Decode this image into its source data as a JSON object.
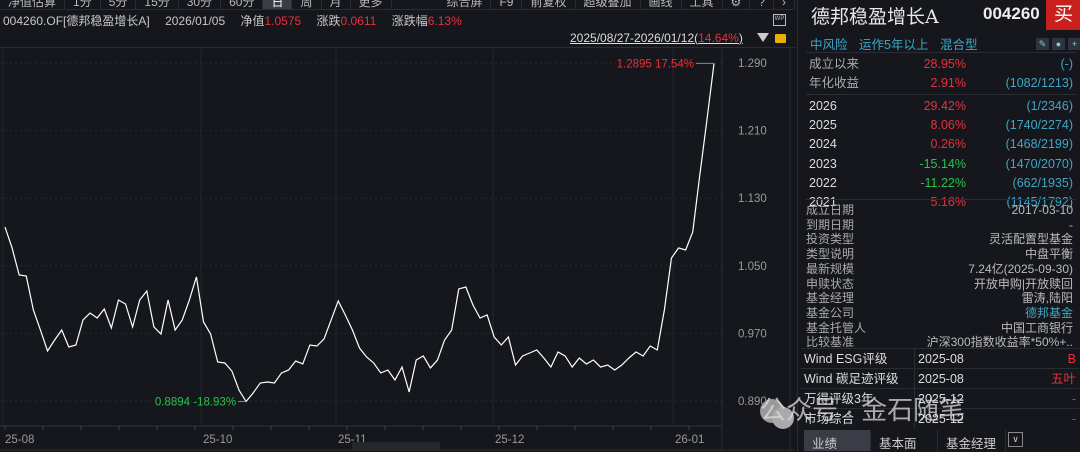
{
  "toolbar": {
    "items": [
      "净值估算",
      "1分",
      "5分",
      "15分",
      "30分",
      "60分",
      "日",
      "周",
      "月",
      "更多"
    ],
    "active": "日",
    "right_items": [
      "综合屏",
      "F9",
      "前复权",
      "超级叠加",
      "画线",
      "工具"
    ],
    "icons": [
      "gear-icon",
      "help-icon",
      "chevron-right-icon"
    ]
  },
  "info": {
    "code_name": "004260.OF[德邦稳盈增长A]",
    "date": "2026/01/05",
    "nav_label": "净值",
    "nav": "1.0575",
    "chg_label": "涨跌",
    "chg": "0.0611",
    "pct_label": "涨跌幅",
    "pct": "6.13%"
  },
  "range": {
    "text": "2025/08/27-2026/01/12(",
    "pct": "14.64%",
    "close": ")"
  },
  "wp_label": "WP",
  "chart_data": {
    "type": "line",
    "start_date": "2025/08/27",
    "end_date": "2026/01/12",
    "ylim": [
      0.86,
      1.31
    ],
    "yticks": [
      "1.290",
      "1.210",
      "1.130",
      "1.050",
      "0.970",
      "0.890"
    ],
    "xticks": [
      "25-08",
      "25-10",
      "25-11",
      "25-12",
      "26-01"
    ],
    "grid": true,
    "color": "#ffffff",
    "max_label": "1.2895 17.54%",
    "min_label": "0.8894 -18.93%",
    "values": [
      1.0959,
      1.0711,
      1.0391,
      1.0379,
      0.9977,
      0.974,
      0.9492,
      0.9622,
      0.974,
      0.9539,
      0.9563,
      0.9859,
      0.9941,
      0.9882,
      0.9989,
      0.9764,
      1.0095,
      1.0048,
      0.9776,
      1.0095,
      1.0202,
      0.9776,
      0.9693,
      1.0095,
      0.974,
      0.9859,
      1.0095,
      1.0368,
      0.9835,
      0.9693,
      0.9362,
      0.935,
      0.9255,
      0.903,
      0.8894,
      0.8995,
      0.9113,
      0.9125,
      0.9113,
      0.9232,
      0.9267,
      0.9373,
      0.9338,
      0.9563,
      0.9551,
      0.9634,
      0.9859,
      1.0084,
      0.9918,
      0.974,
      0.9527,
      0.9421,
      0.935,
      0.9232,
      0.9267,
      0.9149,
      0.9302,
      0.9007,
      0.9385,
      0.9433,
      0.9291,
      0.9385,
      0.9622,
      0.974,
      1.0226,
      1.0249,
      1.0036,
      0.9882,
      0.9918,
      0.9657,
      0.9563,
      0.9657,
      0.9326,
      0.9433,
      0.9468,
      0.9504,
      0.9409,
      0.9302,
      0.948,
      0.9433,
      0.9302,
      0.9409,
      0.9338,
      0.9385,
      0.9302,
      0.9326,
      0.9267,
      0.9326,
      0.9409,
      0.948,
      0.9433,
      0.9551,
      0.9504,
      0.9977,
      1.0592,
      1.0711,
      1.0687,
      1.09,
      1.1575,
      1.2225,
      1.2895
    ]
  },
  "panel": {
    "title": "德邦稳盈增长A",
    "code": "004260",
    "buy": "买",
    "tags": [
      "中风险",
      "运作5年以上",
      "混合型"
    ],
    "perf": [
      {
        "k": "成立以来",
        "v": "28.95%",
        "rank": "(-)",
        "c": "red"
      },
      {
        "k": "年化收益",
        "v": "2.91%",
        "rank": "(1082/1213)",
        "c": "red"
      },
      {
        "k": "2026",
        "v": "29.42%",
        "rank": "(1/2346)",
        "c": "red"
      },
      {
        "k": "2025",
        "v": "8.06%",
        "rank": "(1740/2274)",
        "c": "red"
      },
      {
        "k": "2024",
        "v": "0.26%",
        "rank": "(1468/2199)",
        "c": "red"
      },
      {
        "k": "2023",
        "v": "-15.14%",
        "rank": "(1470/2070)",
        "c": "grn"
      },
      {
        "k": "2022",
        "v": "-11.22%",
        "rank": "(662/1935)",
        "c": "grn"
      },
      {
        "k": "2021",
        "v": "5.16%",
        "rank": "(1145/1792)",
        "c": "red"
      }
    ],
    "details": [
      {
        "k": "成立日期",
        "v": "2017-03-10"
      },
      {
        "k": "到期日期",
        "v": "-"
      },
      {
        "k": "投资类型",
        "v": "灵活配置型基金"
      },
      {
        "k": "类型说明",
        "v": "中盘平衡"
      },
      {
        "k": "最新规模",
        "v": "7.24亿(2025-09-30)"
      },
      {
        "k": "申赎状态",
        "v": "开放申购|开放赎回"
      },
      {
        "k": "基金经理",
        "v": "雷涛,陆阳"
      },
      {
        "k": "基金公司",
        "v": "德邦基金"
      },
      {
        "k": "基金托管人",
        "v": "中国工商银行"
      },
      {
        "k": "比较基准",
        "v": "沪深300指数收益率*50%+.."
      }
    ],
    "ratings": [
      {
        "k": "Wind ESG评级",
        "d": "2025-08",
        "v": "B"
      },
      {
        "k": "Wind 碳足迹评级",
        "d": "2025-08",
        "v": "五叶"
      },
      {
        "k": "万得评级3年",
        "d": "2025-12",
        "v": "-"
      },
      {
        "k": "市场综合",
        "d": "2025-12",
        "v": "-"
      }
    ],
    "tabs": [
      "业绩",
      "基本面",
      "基金经理"
    ]
  },
  "watermark": "公众号 · 金石随笔"
}
